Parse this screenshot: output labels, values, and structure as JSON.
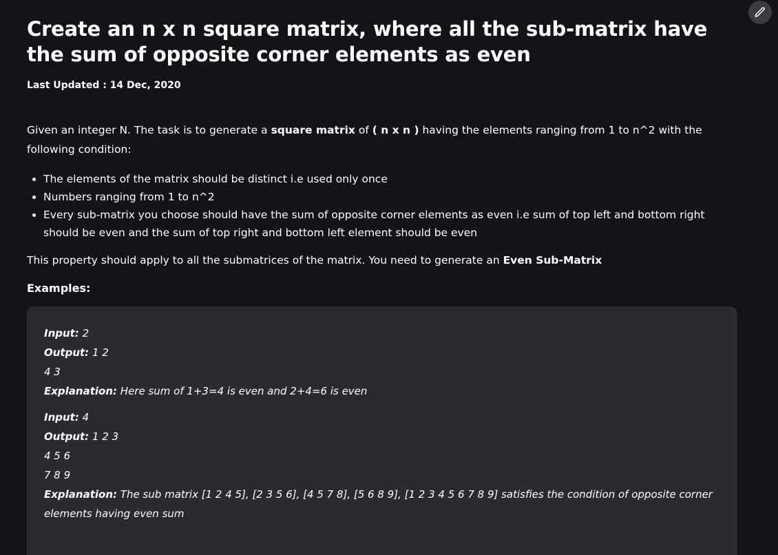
{
  "article": {
    "title": "Create an n x n square matrix, where all the sub-matrix have the sum of opposite corner elements as even",
    "last_updated_label": "Last Updated :",
    "last_updated_date": "14 Dec, 2020",
    "intro": {
      "part1": "Given an integer N. The task is to generate a ",
      "bold1": "square matrix",
      "part2": " of ",
      "bold2": "( n x n )",
      "part3": " having the elements ranging from 1 to n^2 with the following condition:"
    },
    "conditions": [
      "The elements of the matrix should be distinct i.e used only once",
      "Numbers ranging from 1 to n^2",
      "Every sub-matrix you choose should have the sum of opposite corner elements as even i.e sum of top left and bottom right should be even and the sum of top right and bottom left element should be even"
    ],
    "property": {
      "text": "This property should apply to all the submatrices of the matrix. You need to generate an ",
      "bold": "Even Sub-Matrix"
    },
    "examples_heading": "Examples:",
    "examples": [
      {
        "input_label": "Input:",
        "input_value": " 2",
        "output_label": "Output:",
        "output_lines": [
          " 1 2",
          "4 3"
        ],
        "explanation_label": "Explanation:",
        "explanation": " Here sum of 1+3=4 is even and 2+4=6 is even"
      },
      {
        "input_label": "Input:",
        "input_value": " 4",
        "output_label": "Output:",
        "output_lines": [
          " 1 2 3",
          "4 5 6",
          "7 8 9"
        ],
        "explanation_label": "Explanation:",
        "explanation": " The sub matrix [1 2 4 5], [2 3 5 6], [4 5 7 8], [5 6 8 9], [1 2 3 4 5 6 7 8 9] satisfies the condition of opposite corner elements having even sum"
      }
    ]
  },
  "toolbar": {
    "edit_icon": "pencil-icon"
  },
  "colors": {
    "background": "#131417",
    "code_box": "#2a2b2e",
    "edit_button": "#3a3b3f",
    "text": "#ffffff"
  }
}
